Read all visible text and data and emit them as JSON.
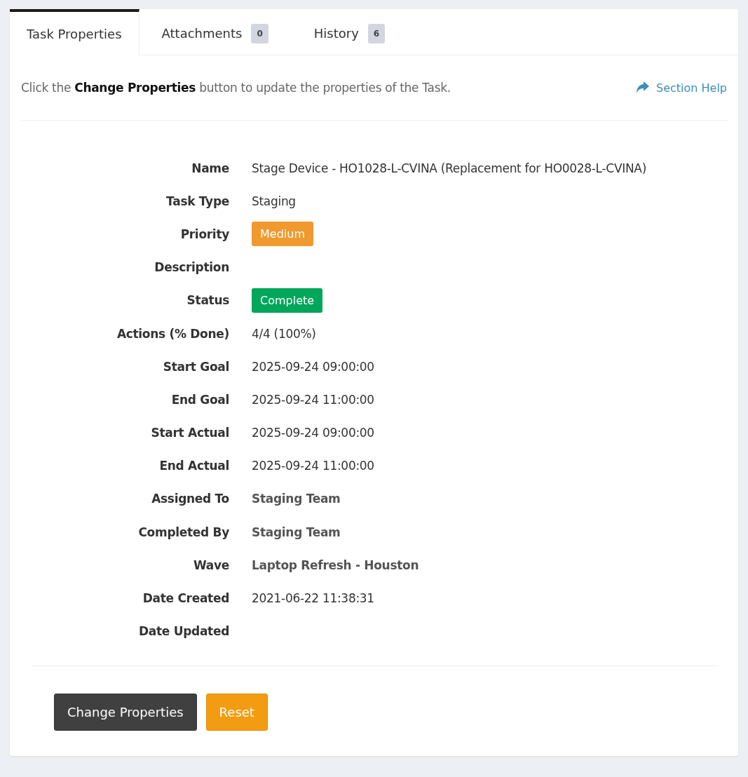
{
  "tabs": [
    {
      "label": "Task Properties",
      "selected": true
    },
    {
      "label": "Attachments",
      "count": "0",
      "selected": false
    },
    {
      "label": "History",
      "count": "6",
      "selected": false
    }
  ],
  "intro": "Click the **Change Properties** button to update the properties of the Task.",
  "help_link": "Section Help",
  "properties": [
    {
      "label": "Name",
      "kind": "text",
      "value": "Stage Device - HO1028-L-CVINA (Replacement for HO0028-L-CVINA)"
    },
    {
      "label": "Task Type",
      "kind": "text",
      "value": "Staging"
    },
    {
      "label": "Priority",
      "kind": "badge",
      "value": "Medium",
      "color": "#f0992e"
    },
    {
      "label": "Description",
      "kind": "empty"
    },
    {
      "label": "Status",
      "kind": "badge",
      "value": "Complete",
      "color": "#00a65a"
    },
    {
      "label": "Actions (% Done)",
      "kind": "text",
      "value": "4/4 (100%)"
    },
    {
      "label": "Start Goal",
      "kind": "text",
      "value": "2025-09-24 09:00:00"
    },
    {
      "label": "End Goal",
      "kind": "text",
      "value": "2025-09-24 11:00:00"
    },
    {
      "label": "Start Actual",
      "kind": "text",
      "value": "2025-09-24 09:00:00"
    },
    {
      "label": "End Actual",
      "kind": "text",
      "value": "2025-09-24 11:00:00"
    },
    {
      "label": "Assigned To",
      "kind": "link",
      "value": "Staging Team"
    },
    {
      "label": "Completed By",
      "kind": "link",
      "value": "Staging Team"
    },
    {
      "label": "Wave",
      "kind": "link",
      "value": "Laptop Refresh - Houston"
    },
    {
      "label": "Date Created",
      "kind": "text",
      "value": "2021-06-22 11:38:31"
    },
    {
      "label": "Date Updated",
      "kind": "empty"
    }
  ],
  "buttons": [
    {
      "label": "Change Properties",
      "kind": "primary"
    },
    {
      "label": "Reset",
      "kind": "warning"
    }
  ]
}
